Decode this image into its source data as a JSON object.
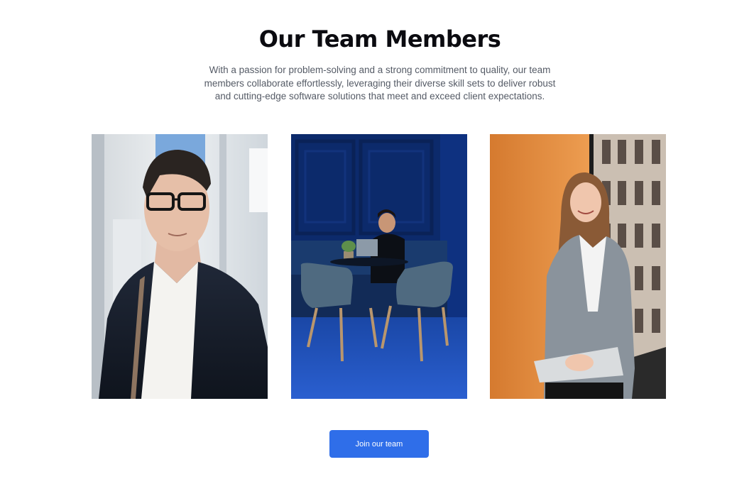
{
  "section": {
    "title": "Our Team Members",
    "description": "With a passion for problem-solving and a strong commitment to quality, our team members collaborate effortlessly, leveraging their diverse skill sets to deliver robust and cutting-edge software solutions that meet and exceed client expectations."
  },
  "team": [
    {
      "photo": "man-in-glasses-and-blazer-photo"
    },
    {
      "photo": "man-with-laptop-blue-lounge-photo"
    },
    {
      "photo": "woman-in-gray-blazer-by-window-photo"
    }
  ],
  "cta": {
    "label": "Join our team",
    "color": "#2f6ee9"
  }
}
